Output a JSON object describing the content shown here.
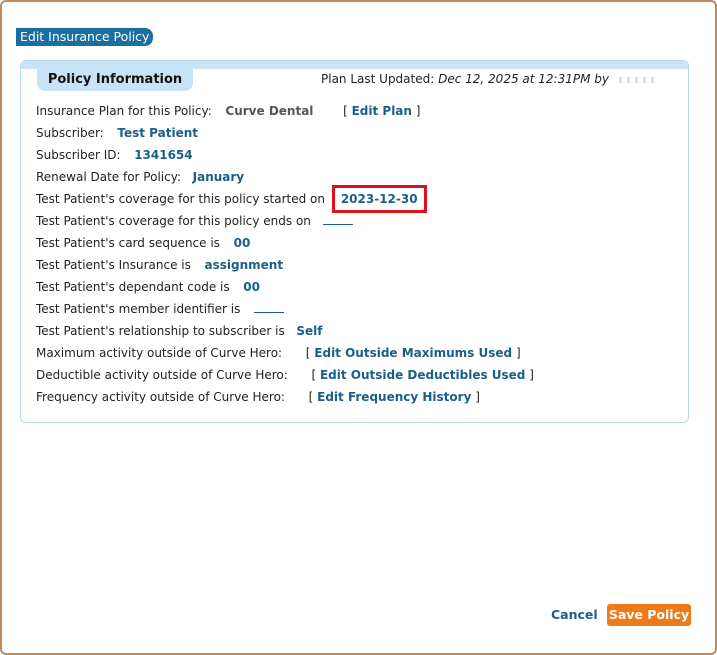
{
  "dialog": {
    "title": "Edit Insurance Policy"
  },
  "panel": {
    "tab_label": "Policy Information",
    "plan_updated_label": "Plan Last Updated:",
    "plan_updated_value": "Dec 12, 2025 at 12:31PM by"
  },
  "fields": {
    "insurance_plan_label": "Insurance Plan for this Policy:",
    "insurance_plan_value": "Curve Dental",
    "edit_plan_link": "Edit Plan",
    "subscriber_label": "Subscriber:",
    "subscriber_value": "Test Patient",
    "subscriber_id_label": "Subscriber ID:",
    "subscriber_id_value": "1341654",
    "renewal_label": "Renewal Date for Policy:",
    "renewal_value": "January",
    "coverage_start_label": "Test Patient's coverage for this policy started on",
    "coverage_start_value": "2023-12-30",
    "coverage_end_label": "Test Patient's coverage for this policy ends on",
    "card_sequence_label": "Test Patient's card sequence is",
    "card_sequence_value": "00",
    "insurance_label": "Test Patient's Insurance is",
    "insurance_value": "assignment",
    "dependant_code_label": "Test Patient's dependant code is",
    "dependant_code_value": "00",
    "member_identifier_label": "Test Patient's member identifier is",
    "relationship_label": "Test Patient's relationship to subscriber is",
    "relationship_value": "Self",
    "max_activity_label": "Maximum activity outside of Curve Hero:",
    "max_activity_link": "Edit Outside Maximums Used",
    "deductible_activity_label": "Deductible activity outside of Curve Hero:",
    "deductible_activity_link": "Edit Outside Deductibles Used",
    "frequency_activity_label": "Frequency activity outside of Curve Hero:",
    "frequency_activity_link": "Edit Frequency History"
  },
  "footer": {
    "cancel_label": "Cancel",
    "save_label": "Save Policy"
  },
  "colors": {
    "accent": "#1a5f8a",
    "title_bg": "#1a6fa0",
    "save_bg": "#ee7a1a",
    "highlight": "#e01020",
    "panel_header": "#c8e2f6"
  }
}
